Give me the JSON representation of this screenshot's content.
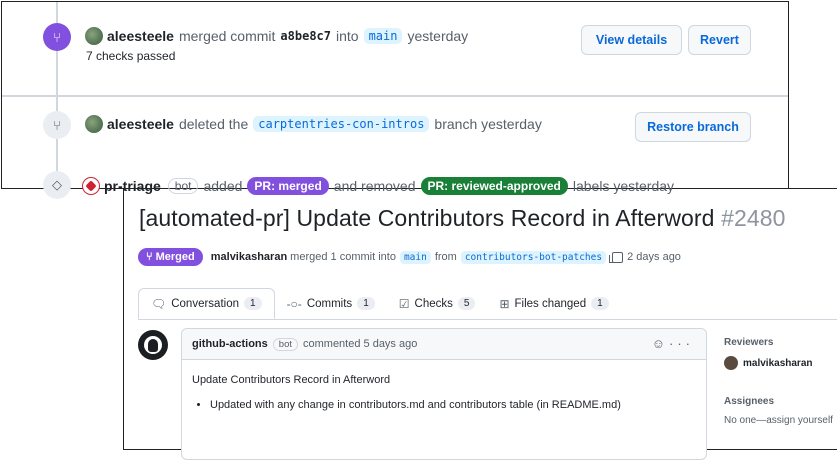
{
  "pr": {
    "title": "[automated-pr] Update Contributors Record in Afterword",
    "number": "#2480",
    "state_label": "Merged",
    "state_icon": "merge-icon",
    "merged_by": "malvikasharan",
    "merge_text": "merged 1 commit into",
    "base_branch": "main",
    "from_text": "from",
    "head_branch": "contributors-bot-patches",
    "time": "2 days ago"
  },
  "tabs": [
    {
      "label": "Conversation",
      "count": "1",
      "icon": "comment-icon"
    },
    {
      "label": "Commits",
      "count": "1",
      "icon": "commit-icon"
    },
    {
      "label": "Checks",
      "count": "5",
      "icon": "checklist-icon"
    },
    {
      "label": "Files changed",
      "count": "1",
      "icon": "file-diff-icon"
    }
  ],
  "comment": {
    "author": "github-actions",
    "bot": "bot",
    "meta": "commented 5 days ago",
    "body_title": "Update Contributors Record in Afterword",
    "bullet": "Updated with any change in contributors.md and contributors table (in README.md)",
    "emoji": "☺",
    "more": "···"
  },
  "sidebar": {
    "reviewers_label": "Reviewers",
    "reviewer": "malvikasharan",
    "assignees_label": "Assignees",
    "assignees_value": "No one—assign yourself"
  },
  "timeline": {
    "merge": {
      "user": "aleesteele",
      "text1": "merged commit",
      "sha": "a8be8c7",
      "text2": "into",
      "branch": "main",
      "time": "yesterday",
      "checks": "7 checks passed",
      "view_details": "View details",
      "revert": "Revert"
    },
    "delete": {
      "user": "aleesteele",
      "text1": "deleted the",
      "branch": "carptentries-con-intros",
      "text2": "branch yesterday",
      "restore": "Restore branch"
    },
    "label": {
      "user": "pr-triage",
      "bot": "bot",
      "added": "added",
      "label_added": "PR: merged",
      "removed": "and removed",
      "label_removed": "PR: reviewed-approved",
      "tail": "labels yesterday"
    }
  },
  "colors": {
    "purple": "#8250df",
    "green": "#1a7f37",
    "link": "#0969da"
  }
}
